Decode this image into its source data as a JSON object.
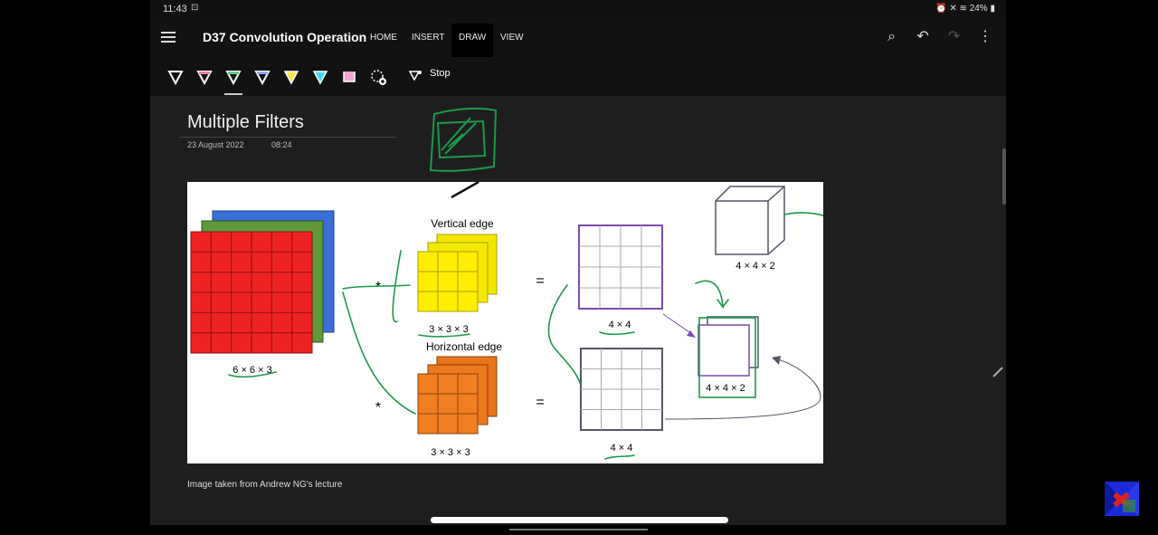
{
  "status": {
    "time": "11:43",
    "battery": "24%"
  },
  "app": {
    "title": "D37 Convolution Operation"
  },
  "tabs": [
    {
      "label": "HOME"
    },
    {
      "label": "INSERT"
    },
    {
      "label": "DRAW"
    },
    {
      "label": "VIEW"
    }
  ],
  "toolbar": {
    "pens": [
      {
        "name": "pen-white",
        "color": "#ffffff"
      },
      {
        "name": "pen-pink",
        "color": "#f07aa0"
      },
      {
        "name": "pen-green",
        "color": "#66cc88"
      },
      {
        "name": "pen-blue",
        "color": "#88aaff"
      },
      {
        "name": "highlighter-yellow",
        "color": "#ffe24a"
      },
      {
        "name": "highlighter-cyan",
        "color": "#3fd8ee"
      },
      {
        "name": "highlighter-pink",
        "color": "#f2a6d0"
      }
    ],
    "stop_label": "Stop"
  },
  "page": {
    "title": "Multiple Filters",
    "date": "23 August 2022",
    "time": "08:24",
    "caption": "Image taken from Andrew NG's lecture"
  },
  "figure": {
    "input_label": "6 × 6 × 3",
    "filter1_title": "Vertical edge",
    "filter1_label": "3 × 3 × 3",
    "filter2_title": "Horizontal edge",
    "filter2_label": "3 × 3 × 3",
    "out1_label": "4 × 4",
    "out2_label": "4 × 4",
    "stack_label": "4 × 4 × 2",
    "cube_label": "4 × 4 × 2",
    "op_conv": "*",
    "op_eq": "="
  }
}
